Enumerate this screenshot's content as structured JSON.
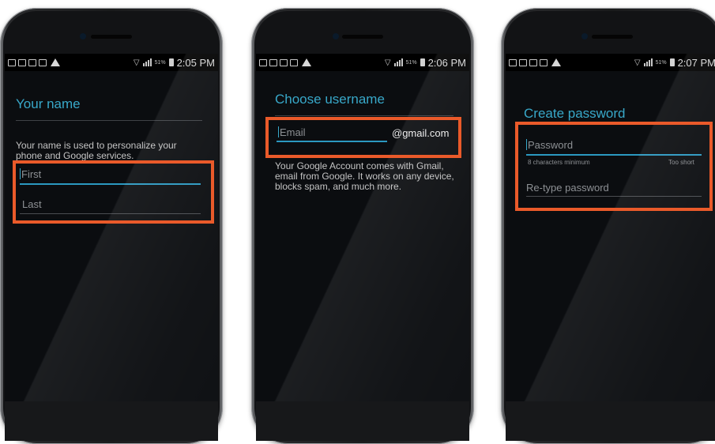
{
  "accent_color": "#ea5a2a",
  "title_color": "#38a8c9",
  "phones": [
    {
      "status_time": "2:05 PM",
      "battery_pct": "51%",
      "title": "Your name",
      "description": "Your name is used to personalize your phone and Google services.",
      "fields": [
        {
          "placeholder": "First",
          "active": true
        },
        {
          "placeholder": "Last",
          "active": false
        }
      ]
    },
    {
      "status_time": "2:06 PM",
      "battery_pct": "51%",
      "title": "Choose username",
      "field": {
        "placeholder": "Email",
        "suffix": "@gmail.com"
      },
      "description": "Your Google Account comes with Gmail, email from Google. It works on any device, blocks spam, and much more."
    },
    {
      "status_time": "2:07 PM",
      "battery_pct": "51%",
      "title": "Create password",
      "fields": [
        {
          "placeholder": "Password",
          "hint": "8 characters minimum",
          "status": "Too short"
        },
        {
          "placeholder": "Re-type password"
        }
      ]
    }
  ]
}
